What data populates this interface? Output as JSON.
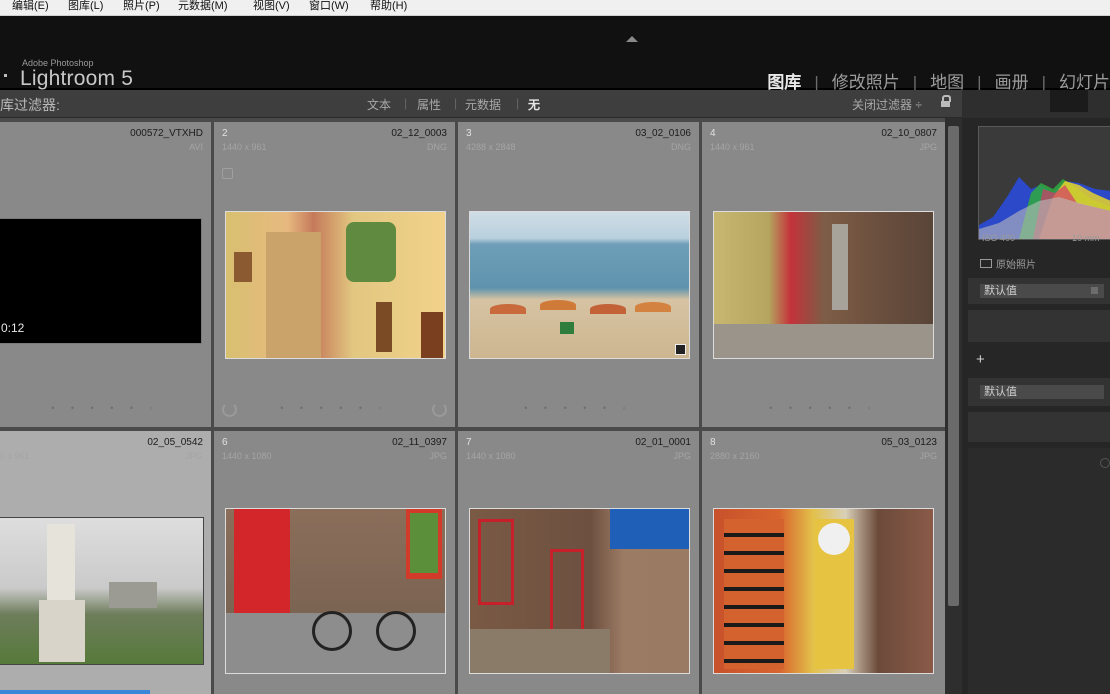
{
  "menu": [
    "编辑(E)",
    "图库(L)",
    "照片(P)",
    "元数据(M)",
    "视图(V)",
    "窗口(W)",
    "帮助(H)"
  ],
  "brand": {
    "small": "Adobe Photoshop",
    "name": "Lightroom 5"
  },
  "modules": [
    "图库",
    "修改照片",
    "地图",
    "画册",
    "幻灯片"
  ],
  "active_module": "图库",
  "filter": {
    "title": "库过滤器:",
    "options": [
      "文本",
      "属性",
      "元数据",
      "无"
    ],
    "selected": "无",
    "close_label": "关闭过滤器 ÷"
  },
  "photos": [
    {
      "num": "",
      "name": "000572_VTXHD",
      "dims": "",
      "type": "AVI",
      "time": "0:12"
    },
    {
      "num": "2",
      "name": "02_12_0003",
      "dims": "1440 x 961",
      "type": "DNG"
    },
    {
      "num": "3",
      "name": "03_02_0106",
      "dims": "4288 x 2848",
      "type": "DNG"
    },
    {
      "num": "4",
      "name": "02_10_0807",
      "dims": "1440 x 961",
      "type": "JPG"
    },
    {
      "num": "",
      "name": "02_05_0542",
      "dims": "0 x 961",
      "type": "JPG"
    },
    {
      "num": "6",
      "name": "02_11_0397",
      "dims": "1440 x 1080",
      "type": "JPG"
    },
    {
      "num": "7",
      "name": "02_01_0001",
      "dims": "1440 x 1080",
      "type": "JPG"
    },
    {
      "num": "8",
      "name": "05_03_0123",
      "dims": "2880 x 2160",
      "type": "JPG"
    }
  ],
  "histogram": {
    "iso": "ISO 400",
    "focal": "10 mm",
    "original_label": "原始照片"
  },
  "quick_develop": {
    "preset_1": "默认值",
    "preset_2": "默认值"
  },
  "colors": {
    "accent_progress": "#3a86d8",
    "cell": "#898989",
    "cell_selected": "#adadad"
  }
}
